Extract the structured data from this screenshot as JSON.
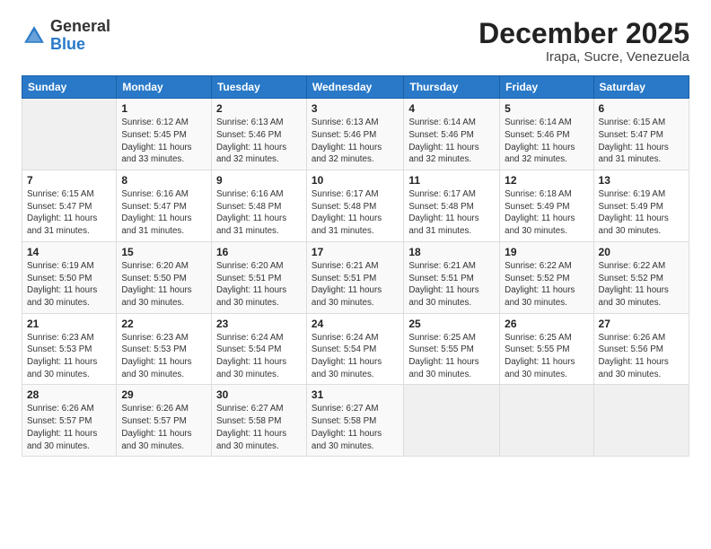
{
  "logo": {
    "general": "General",
    "blue": "Blue"
  },
  "title": "December 2025",
  "subtitle": "Irapa, Sucre, Venezuela",
  "header_days": [
    "Sunday",
    "Monday",
    "Tuesday",
    "Wednesday",
    "Thursday",
    "Friday",
    "Saturday"
  ],
  "weeks": [
    [
      {
        "day": "",
        "info": ""
      },
      {
        "day": "1",
        "info": "Sunrise: 6:12 AM\nSunset: 5:45 PM\nDaylight: 11 hours\nand 33 minutes."
      },
      {
        "day": "2",
        "info": "Sunrise: 6:13 AM\nSunset: 5:46 PM\nDaylight: 11 hours\nand 32 minutes."
      },
      {
        "day": "3",
        "info": "Sunrise: 6:13 AM\nSunset: 5:46 PM\nDaylight: 11 hours\nand 32 minutes."
      },
      {
        "day": "4",
        "info": "Sunrise: 6:14 AM\nSunset: 5:46 PM\nDaylight: 11 hours\nand 32 minutes."
      },
      {
        "day": "5",
        "info": "Sunrise: 6:14 AM\nSunset: 5:46 PM\nDaylight: 11 hours\nand 32 minutes."
      },
      {
        "day": "6",
        "info": "Sunrise: 6:15 AM\nSunset: 5:47 PM\nDaylight: 11 hours\nand 31 minutes."
      }
    ],
    [
      {
        "day": "7",
        "info": "Sunrise: 6:15 AM\nSunset: 5:47 PM\nDaylight: 11 hours\nand 31 minutes."
      },
      {
        "day": "8",
        "info": "Sunrise: 6:16 AM\nSunset: 5:47 PM\nDaylight: 11 hours\nand 31 minutes."
      },
      {
        "day": "9",
        "info": "Sunrise: 6:16 AM\nSunset: 5:48 PM\nDaylight: 11 hours\nand 31 minutes."
      },
      {
        "day": "10",
        "info": "Sunrise: 6:17 AM\nSunset: 5:48 PM\nDaylight: 11 hours\nand 31 minutes."
      },
      {
        "day": "11",
        "info": "Sunrise: 6:17 AM\nSunset: 5:48 PM\nDaylight: 11 hours\nand 31 minutes."
      },
      {
        "day": "12",
        "info": "Sunrise: 6:18 AM\nSunset: 5:49 PM\nDaylight: 11 hours\nand 30 minutes."
      },
      {
        "day": "13",
        "info": "Sunrise: 6:19 AM\nSunset: 5:49 PM\nDaylight: 11 hours\nand 30 minutes."
      }
    ],
    [
      {
        "day": "14",
        "info": "Sunrise: 6:19 AM\nSunset: 5:50 PM\nDaylight: 11 hours\nand 30 minutes."
      },
      {
        "day": "15",
        "info": "Sunrise: 6:20 AM\nSunset: 5:50 PM\nDaylight: 11 hours\nand 30 minutes."
      },
      {
        "day": "16",
        "info": "Sunrise: 6:20 AM\nSunset: 5:51 PM\nDaylight: 11 hours\nand 30 minutes."
      },
      {
        "day": "17",
        "info": "Sunrise: 6:21 AM\nSunset: 5:51 PM\nDaylight: 11 hours\nand 30 minutes."
      },
      {
        "day": "18",
        "info": "Sunrise: 6:21 AM\nSunset: 5:51 PM\nDaylight: 11 hours\nand 30 minutes."
      },
      {
        "day": "19",
        "info": "Sunrise: 6:22 AM\nSunset: 5:52 PM\nDaylight: 11 hours\nand 30 minutes."
      },
      {
        "day": "20",
        "info": "Sunrise: 6:22 AM\nSunset: 5:52 PM\nDaylight: 11 hours\nand 30 minutes."
      }
    ],
    [
      {
        "day": "21",
        "info": "Sunrise: 6:23 AM\nSunset: 5:53 PM\nDaylight: 11 hours\nand 30 minutes."
      },
      {
        "day": "22",
        "info": "Sunrise: 6:23 AM\nSunset: 5:53 PM\nDaylight: 11 hours\nand 30 minutes."
      },
      {
        "day": "23",
        "info": "Sunrise: 6:24 AM\nSunset: 5:54 PM\nDaylight: 11 hours\nand 30 minutes."
      },
      {
        "day": "24",
        "info": "Sunrise: 6:24 AM\nSunset: 5:54 PM\nDaylight: 11 hours\nand 30 minutes."
      },
      {
        "day": "25",
        "info": "Sunrise: 6:25 AM\nSunset: 5:55 PM\nDaylight: 11 hours\nand 30 minutes."
      },
      {
        "day": "26",
        "info": "Sunrise: 6:25 AM\nSunset: 5:55 PM\nDaylight: 11 hours\nand 30 minutes."
      },
      {
        "day": "27",
        "info": "Sunrise: 6:26 AM\nSunset: 5:56 PM\nDaylight: 11 hours\nand 30 minutes."
      }
    ],
    [
      {
        "day": "28",
        "info": "Sunrise: 6:26 AM\nSunset: 5:57 PM\nDaylight: 11 hours\nand 30 minutes."
      },
      {
        "day": "29",
        "info": "Sunrise: 6:26 AM\nSunset: 5:57 PM\nDaylight: 11 hours\nand 30 minutes."
      },
      {
        "day": "30",
        "info": "Sunrise: 6:27 AM\nSunset: 5:58 PM\nDaylight: 11 hours\nand 30 minutes."
      },
      {
        "day": "31",
        "info": "Sunrise: 6:27 AM\nSunset: 5:58 PM\nDaylight: 11 hours\nand 30 minutes."
      },
      {
        "day": "",
        "info": ""
      },
      {
        "day": "",
        "info": ""
      },
      {
        "day": "",
        "info": ""
      }
    ]
  ]
}
